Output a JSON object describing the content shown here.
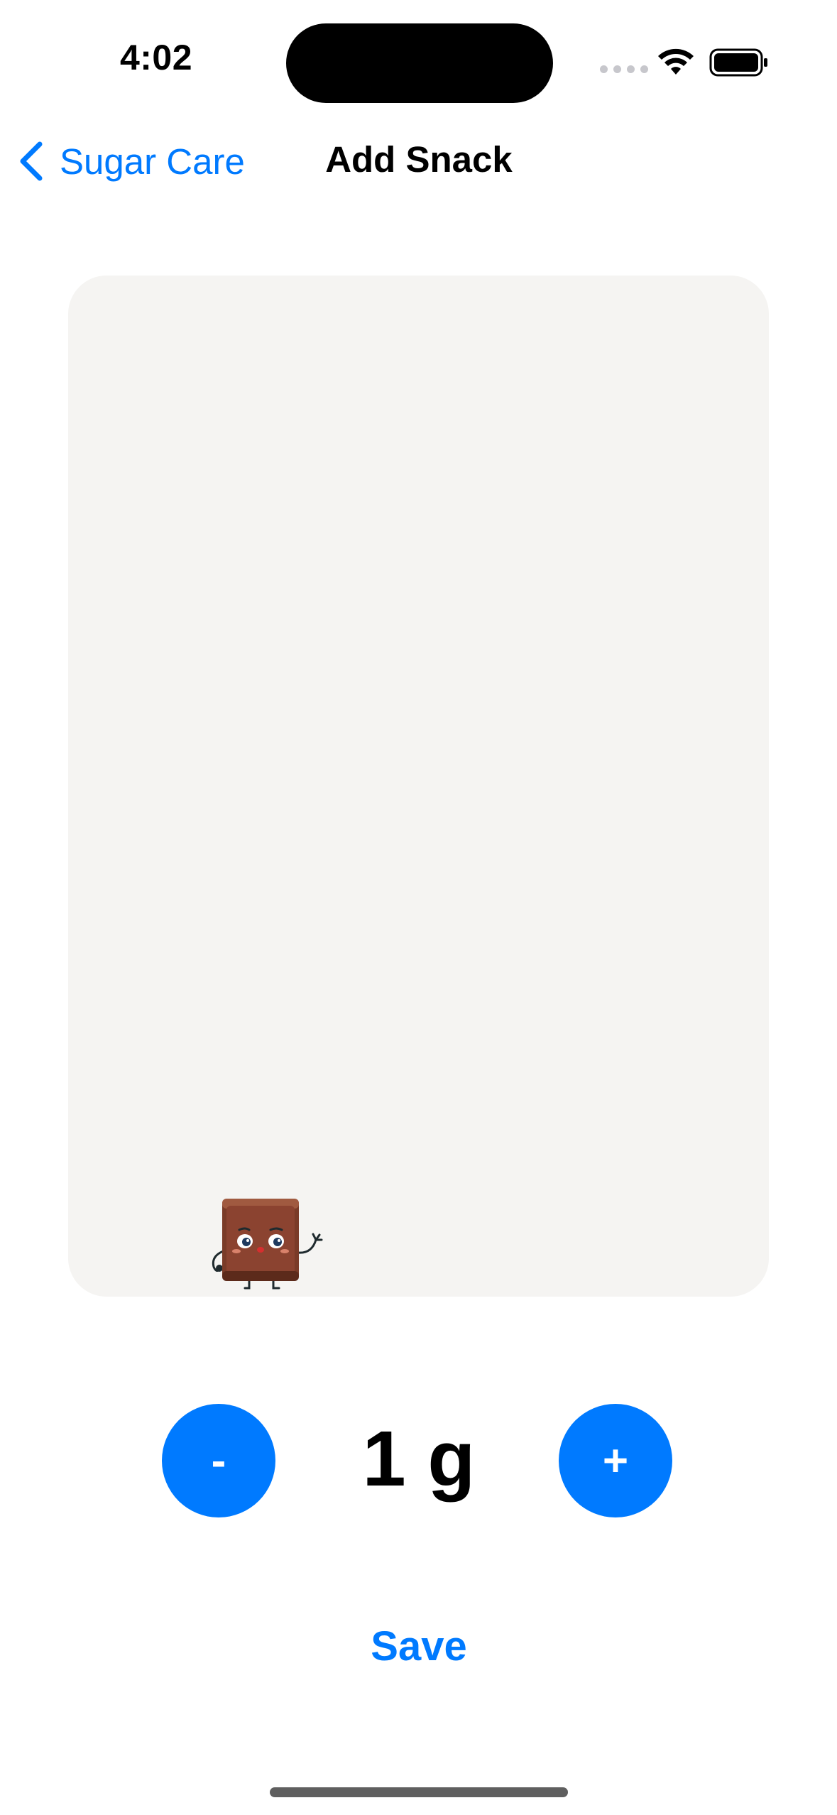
{
  "status_bar": {
    "time": "4:02",
    "signal_icon": "cellular-signal-icon",
    "wifi_icon": "wifi-icon",
    "battery_icon": "battery-icon"
  },
  "nav": {
    "back_label": "Sugar Care",
    "back_icon": "chevron-left-icon",
    "title": "Add Snack"
  },
  "canvas": {
    "background": "#f5f4f2",
    "snack_icon": "chocolate-character-icon"
  },
  "stepper": {
    "minus_label": "-",
    "amount": "1 g",
    "plus_label": "+"
  },
  "actions": {
    "save_label": "Save"
  },
  "colors": {
    "accent": "#007aff",
    "text": "#000000",
    "canvas": "#f5f4f2"
  }
}
